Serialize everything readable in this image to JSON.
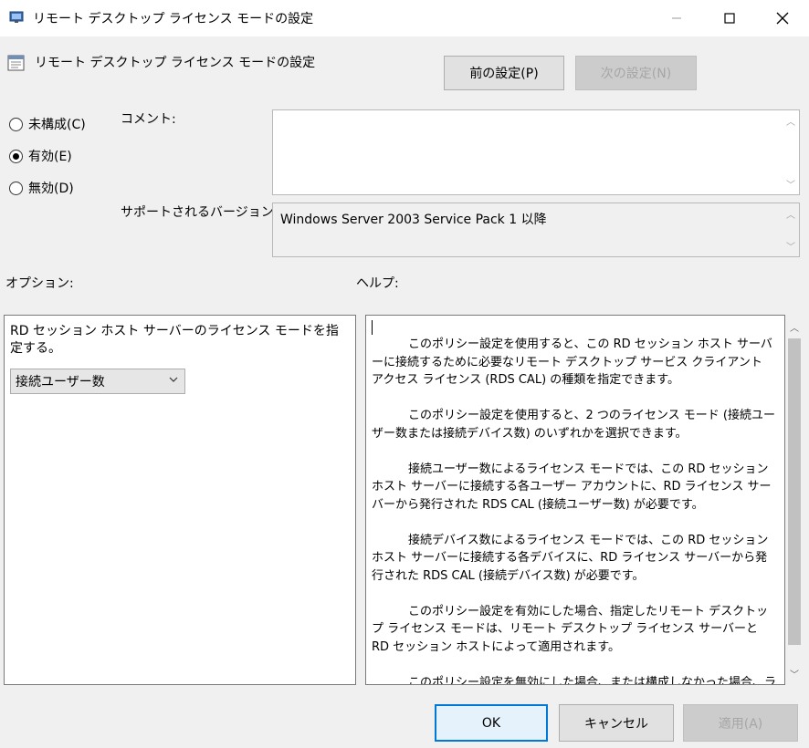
{
  "window": {
    "title": "リモート デスクトップ ライセンス モードの設定"
  },
  "policy_title": "リモート デスクトップ ライセンス モードの設定",
  "nav": {
    "prev_label": "前の設定(P)",
    "next_label": "次の設定(N)"
  },
  "state_options": [
    {
      "label": "未構成(C)",
      "checked": false
    },
    {
      "label": "有効(E)",
      "checked": true
    },
    {
      "label": "無効(D)",
      "checked": false
    }
  ],
  "comment": {
    "label": "コメント:",
    "value": ""
  },
  "supported": {
    "label": "サポートされるバージョン:",
    "value": "Windows Server 2003 Service Pack 1 以降"
  },
  "options": {
    "label": "オプション:",
    "description": "RD セッション ホスト サーバーのライセンス モードを指定する。",
    "selected": "接続ユーザー数"
  },
  "help": {
    "label": "ヘルプ:",
    "paragraphs": [
      "このポリシー設定を使用すると、この RD セッション ホスト サーバーに接続するために必要なリモート デスクトップ サービス クライアント アクセス ライセンス (RDS CAL) の種類を指定できます。",
      "このポリシー設定を使用すると、2 つのライセンス モード (接続ユーザー数または接続デバイス数) のいずれかを選択できます。",
      "接続ユーザー数によるライセンス モードでは、この RD セッション ホスト サーバーに接続する各ユーザー アカウントに、RD ライセンス サーバーから発行された RDS CAL (接続ユーザー数) が必要です。",
      "接続デバイス数によるライセンス モードでは、この RD セッション ホスト サーバーに接続する各デバイスに、RD ライセンス サーバーから発行された RDS CAL (接続デバイス数) が必要です。",
      "このポリシー設定を有効にした場合、指定したリモート デスクトップ ライセンス モードは、リモート デスクトップ ライセンス サーバーと RD セッション ホストによって適用されます。",
      "このポリシー設定を無効にした場合、または構成しなかった場合、ラ"
    ]
  },
  "footer": {
    "ok_label": "OK",
    "cancel_label": "キャンセル",
    "apply_label": "適用(A)"
  }
}
